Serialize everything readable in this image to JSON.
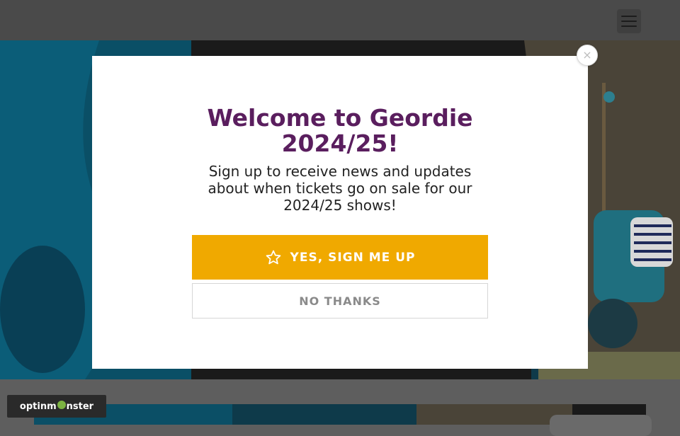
{
  "header": {
    "menu_icon": "hamburger-icon"
  },
  "popup": {
    "title": "Welcome to Geordie 2024/25!",
    "subtitle": "Sign up to receive news and updates about when tickets go on sale for our 2024/25 shows!",
    "yes_label": "YES, SIGN ME UP",
    "yes_icon": "star-outline-icon",
    "no_label": "NO THANKS",
    "close_glyph": "×",
    "close_icon": "close-icon"
  },
  "badge": {
    "brand": "optinmonster"
  },
  "colors": {
    "title": "#5a1e5e",
    "yes_button": "#f0a900",
    "popup_bg": "#ffffff"
  }
}
